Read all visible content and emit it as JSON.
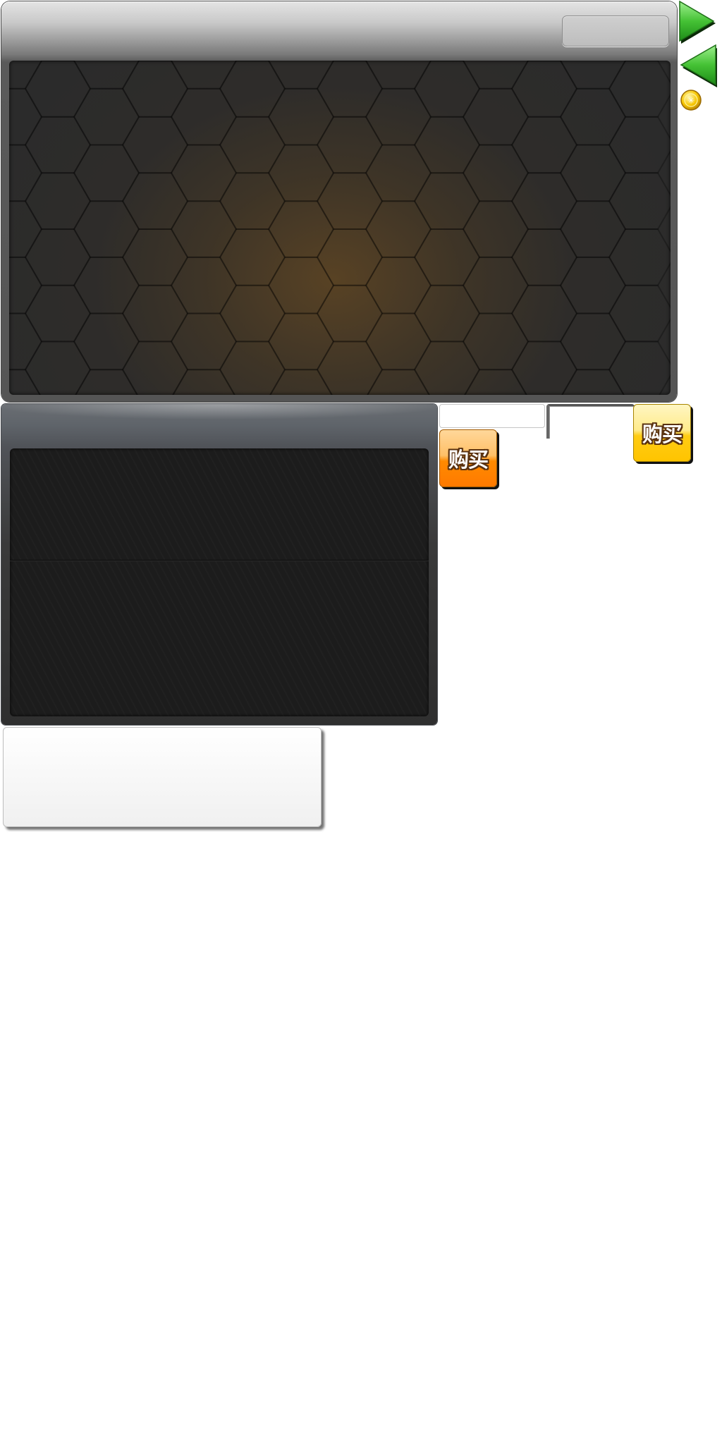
{
  "shop": {
    "title_field": "",
    "content": ""
  },
  "navigation": {
    "next_icon": "arrow-right-green",
    "prev_icon": "arrow-left-green",
    "currency_icon": "gold-coin"
  },
  "item_list": {
    "rows": [
      "",
      ""
    ]
  },
  "buttons": {
    "buy_primary": "购买",
    "buy_secondary": "购买"
  },
  "colors": {
    "panel_dark": "#2b2b2b",
    "buy_orange": "#ff8a00",
    "buy_yellow": "#ffcc14",
    "arrow_green": "#3cb52e",
    "coin_gold": "#f7c600"
  }
}
